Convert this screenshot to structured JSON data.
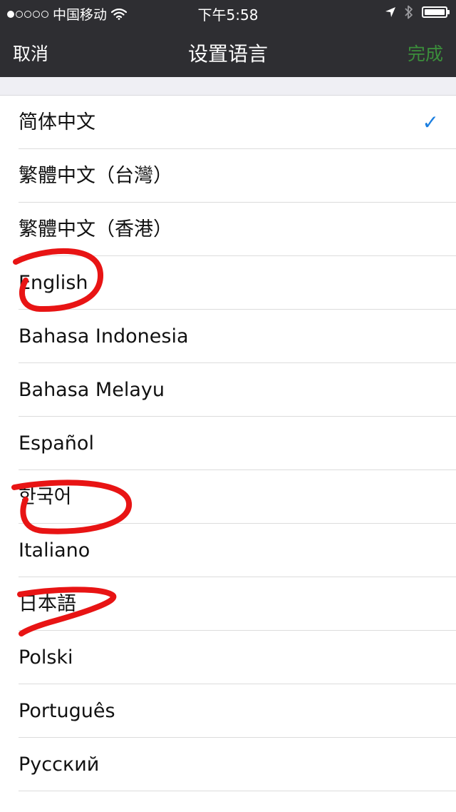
{
  "status_bar": {
    "carrier": "中国移动",
    "time": "下午5:58",
    "signal_filled": 1,
    "signal_total": 5
  },
  "nav": {
    "cancel": "取消",
    "title": "设置语言",
    "done": "完成"
  },
  "languages": [
    {
      "label": "简体中文",
      "selected": true
    },
    {
      "label": "繁體中文（台灣）"
    },
    {
      "label": "繁體中文（香港）"
    },
    {
      "label": "English"
    },
    {
      "label": "Bahasa Indonesia"
    },
    {
      "label": "Bahasa Melayu"
    },
    {
      "label": "Español"
    },
    {
      "label": "한국어"
    },
    {
      "label": "Italiano"
    },
    {
      "label": "日本語"
    },
    {
      "label": "Polski"
    },
    {
      "label": "Português"
    },
    {
      "label": "Русский"
    }
  ],
  "check_glyph": "✓",
  "colors": {
    "bar_background": "#2e2e32",
    "done_green": "#3b8e3b",
    "check_blue": "#1a7ee0",
    "annotation_red": "#e81414"
  }
}
